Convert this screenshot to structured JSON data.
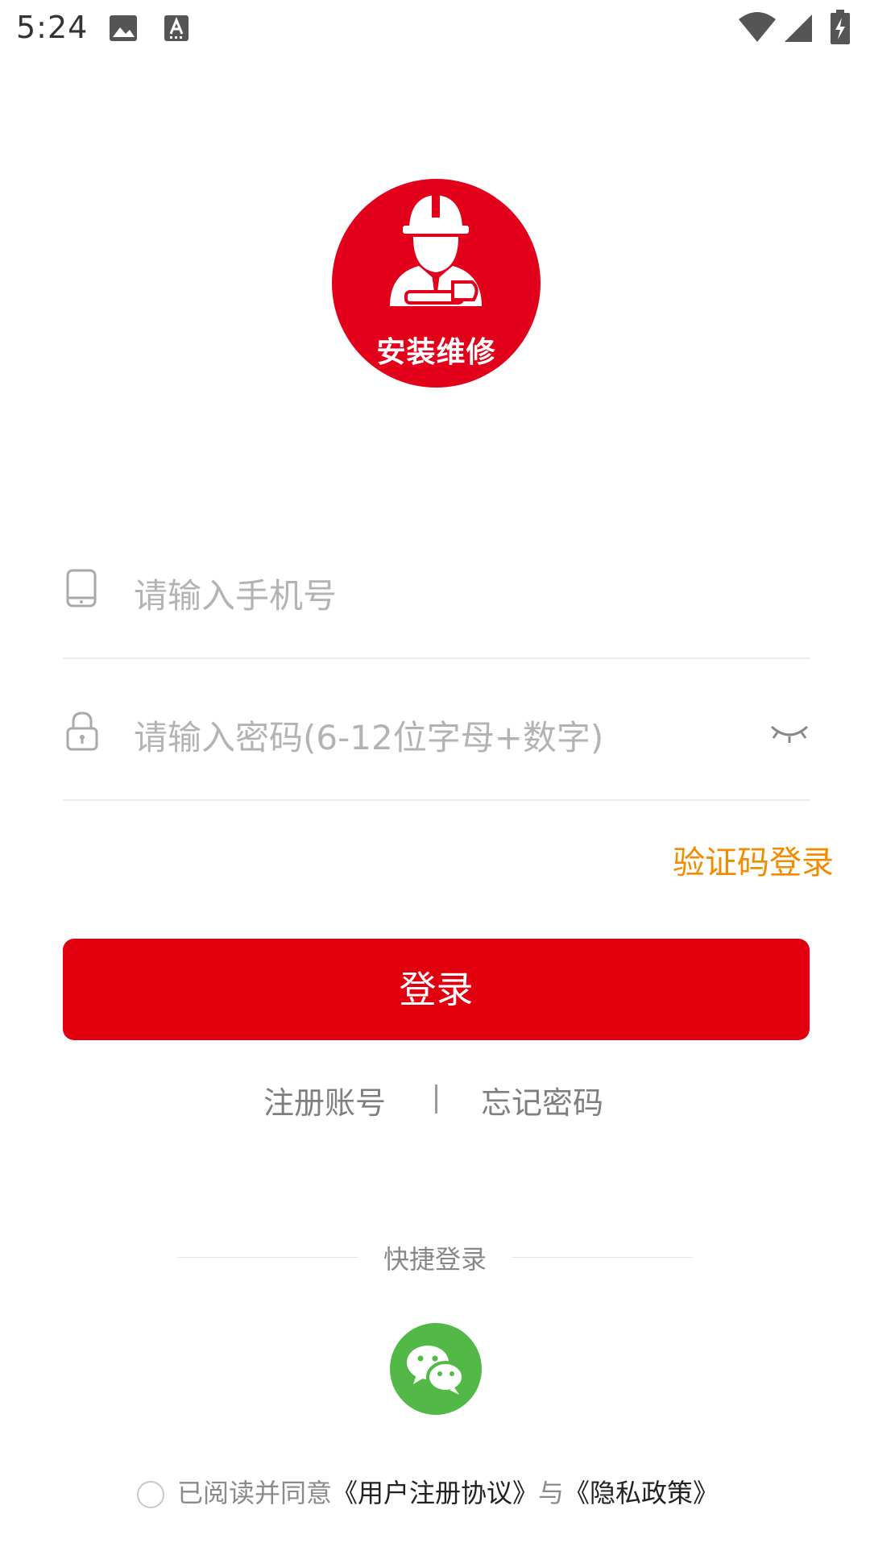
{
  "status_bar": {
    "time": "5:24"
  },
  "logo": {
    "text": "安装维修",
    "color": "#e2001a"
  },
  "phone_input": {
    "placeholder": "请输入手机号"
  },
  "password_input": {
    "placeholder": "请输入密码(6-12位字母+数字)"
  },
  "sms_login_label": "验证码登录",
  "login_button": {
    "label": "登录",
    "color": "#e2000f"
  },
  "links": {
    "register": "注册账号",
    "separator": "|",
    "forgot": "忘记密码"
  },
  "quick_login": {
    "label": "快捷登录",
    "wechat_color": "#52b947"
  },
  "agreement": {
    "prefix": "已阅读并同意",
    "user_agreement": "《用户注册协议》",
    "and": "与",
    "privacy": "《隐私政策》"
  },
  "accent_color": "#f08c00"
}
